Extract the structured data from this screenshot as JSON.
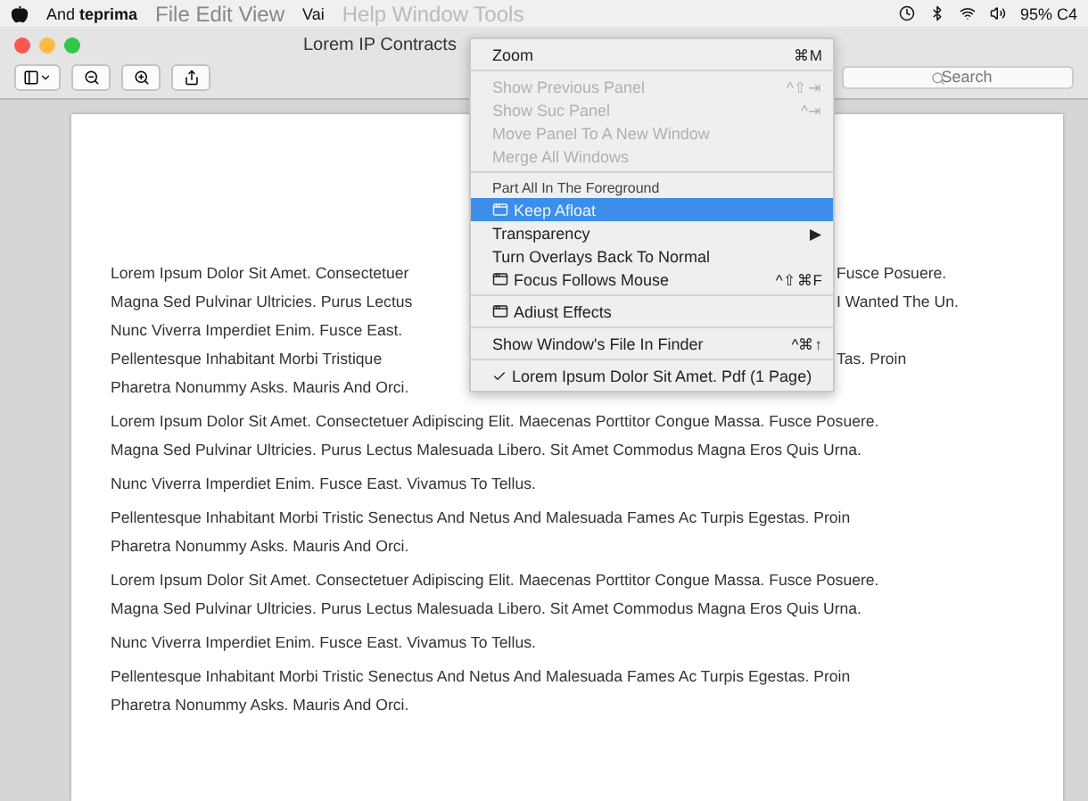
{
  "menu_bar": {
    "app": "And",
    "app_bold": "teprima",
    "menus": [
      "File Edit View",
      "Vai"
    ],
    "ghost_menu": "Help Window Tools",
    "status": "95% C4"
  },
  "window": {
    "title": "Lorem IP Contracts",
    "search": {
      "placeholder": "Search"
    }
  },
  "window_menu": {
    "items": [
      {
        "kind": "plain",
        "label": "Zoom",
        "shortcut": "⌘M",
        "disabled": false,
        "selected": false
      },
      {
        "kind": "separator"
      },
      {
        "kind": "plain",
        "label": "Show Previous Panel",
        "shortcut": "^⇧⇥",
        "disabled": true,
        "selected": false
      },
      {
        "kind": "plain",
        "label": "Show Suc Panel",
        "shortcut": "^⇥",
        "disabled": true,
        "selected": false
      },
      {
        "kind": "plain",
        "label": "Move Panel To A New Window",
        "disabled": true,
        "selected": false
      },
      {
        "kind": "plain",
        "label": "Merge All Windows",
        "disabled": true,
        "selected": false
      },
      {
        "kind": "separator"
      },
      {
        "kind": "header",
        "label": "Part All In The Foreground"
      },
      {
        "kind": "icon",
        "label": "Keep Afloat",
        "disabled": false,
        "selected": true
      },
      {
        "kind": "submenu",
        "label": "Transparency",
        "arrow": "▶",
        "disabled": false,
        "selected": false
      },
      {
        "kind": "plain",
        "label": "Turn Overlays Back To Normal",
        "disabled": false,
        "selected": false
      },
      {
        "kind": "icon",
        "label": "Focus Follows Mouse",
        "shortcut": "^⇧⌘F",
        "disabled": false,
        "selected": false
      },
      {
        "kind": "separator"
      },
      {
        "kind": "icon",
        "label": "Adiust Effects",
        "disabled": false,
        "selected": false
      },
      {
        "kind": "separator"
      },
      {
        "kind": "plain",
        "label": "Show Window's File In Finder",
        "shortcut": "^⌘↑",
        "disabled": false,
        "selected": false
      },
      {
        "kind": "separator"
      },
      {
        "kind": "check",
        "label": "Lorem Ipsum Dolor Sit Amet. Pdf (1 Page)",
        "checked": true,
        "disabled": false,
        "selected": false
      }
    ]
  },
  "document": {
    "lines_under_menu": [
      {
        "text": "Lorem Ipsum Dolor Sit Amet. Consectetuer",
        "right": "Fusce Posuere."
      },
      {
        "text": "Magna Sed Pulvinar Ultricies. Purus Lectus",
        "right": "I Wanted The Un."
      },
      {
        "text": "Nunc Viverra Imperdiet Enim. Fusce East."
      },
      {
        "text": "Pellentesque Inhabitant Morbi Tristique",
        "right": "Tas. Proin"
      },
      {
        "text": "Pharetra Nonummy Asks. Mauris And Orci."
      }
    ],
    "paragraphs": [
      [
        "Lorem Ipsum Dolor Sit Amet. Consectetuer Adipiscing Elit. Maecenas Porttitor Congue Massa. Fusce Posuere.",
        "Magna Sed Pulvinar Ultricies. Purus Lectus Malesuada Libero. Sit Amet Commodus Magna Eros Quis Urna."
      ],
      [
        "Nunc Viverra Imperdiet Enim. Fusce East. Vivamus To Tellus."
      ],
      [
        "Pellentesque Inhabitant Morbi Tristic Senectus And Netus And Malesuada Fames Ac Turpis Egestas. Proin",
        "Pharetra Nonummy Asks. Mauris And Orci."
      ],
      [
        "Lorem Ipsum Dolor Sit Amet. Consectetuer Adipiscing Elit. Maecenas Porttitor Congue Massa. Fusce Posuere.",
        "Magna Sed Pulvinar Ultricies. Purus Lectus Malesuada Libero. Sit Amet Commodus Magna Eros Quis Urna."
      ],
      [
        "Nunc Viverra Imperdiet Enim. Fusce East. Vivamus To Tellus."
      ],
      [
        "Pellentesque Inhabitant Morbi Tristic Senectus And Netus And Malesuada Fames Ac Turpis Egestas. Proin",
        "Pharetra Nonummy Asks. Mauris And Orci."
      ]
    ]
  }
}
